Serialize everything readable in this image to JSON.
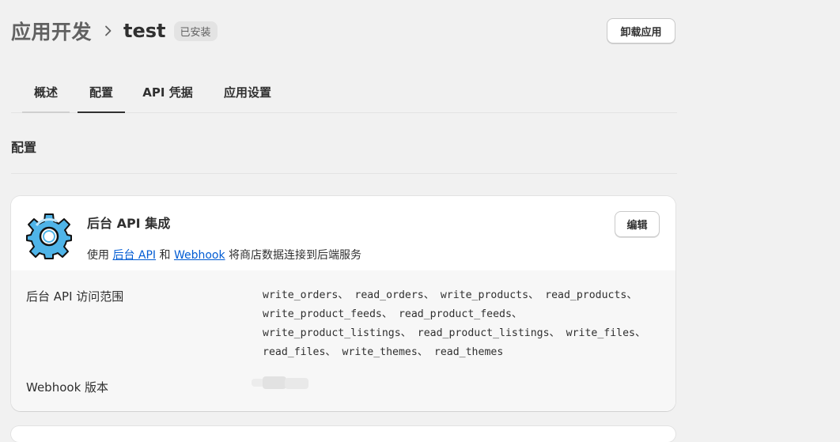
{
  "header": {
    "breadcrumb": "应用开发",
    "title": "test",
    "badge": "已安装",
    "uninstall_label": "卸载应用"
  },
  "tabs": [
    {
      "label": "概述"
    },
    {
      "label": "配置",
      "active": true
    },
    {
      "label": "API 凭据"
    },
    {
      "label": "应用设置"
    }
  ],
  "section_title": "配置",
  "card": {
    "icon": "gear-icon",
    "title": "后台 API 集成",
    "desc_prefix": "使用 ",
    "link1": "后台 API",
    "desc_and": " 和 ",
    "link2": "Webhook",
    "desc_suffix": " 将商店数据连接到后端服务",
    "edit_label": "编辑",
    "scopes_label": "后台 API 访问范围",
    "scope_lines": [
      "write_orders、 read_orders、 write_products、 read_products、",
      "write_product_feeds、 read_product_feeds、",
      "write_product_listings、 read_product_listings、 write_files、",
      "read_files、 write_themes、 read_themes"
    ],
    "webhook_label": "Webhook 版本"
  },
  "colors": {
    "accent_link": "#005bd3",
    "gear_blue": "#4fb4e8",
    "background": "#f1f1f1"
  }
}
